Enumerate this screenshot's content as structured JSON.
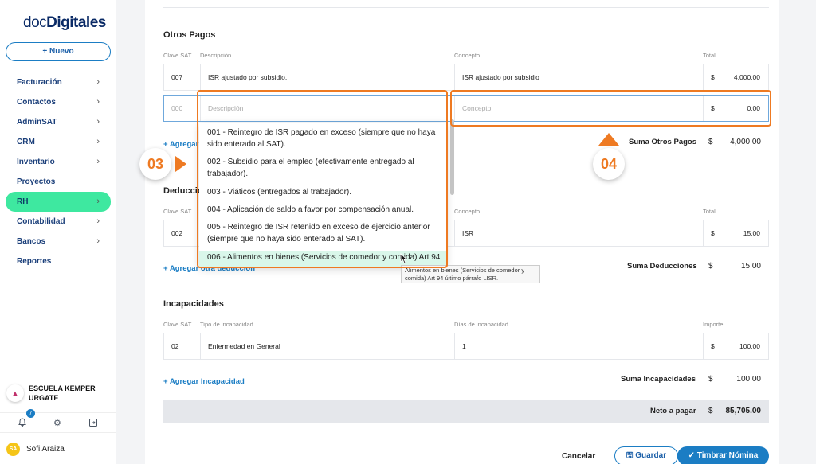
{
  "brand": {
    "logo_light": "doc",
    "logo_bold": "Digitales"
  },
  "sidebar": {
    "new_button": "+ Nuevo",
    "items": [
      {
        "label": "Facturación",
        "chevron": true
      },
      {
        "label": "Contactos",
        "chevron": true
      },
      {
        "label": "AdminSAT",
        "chevron": true
      },
      {
        "label": "CRM",
        "chevron": true
      },
      {
        "label": "Inventario",
        "chevron": true
      },
      {
        "label": "Proyectos",
        "chevron": false
      },
      {
        "label": "RH",
        "chevron": true,
        "active": true
      },
      {
        "label": "Contabilidad",
        "chevron": true
      },
      {
        "label": "Bancos",
        "chevron": true
      },
      {
        "label": "Reportes",
        "chevron": false
      }
    ],
    "org_name": "ESCUELA KEMPER URGATE",
    "notification_count": "7",
    "user_initials": "SA",
    "user_name": "Sofi Araiza"
  },
  "otros_pagos": {
    "title": "Otros Pagos",
    "headers": {
      "clave": "Clave SAT",
      "descripcion": "Descripción",
      "concepto": "Concepto",
      "total": "Total"
    },
    "row": {
      "clave": "007",
      "descripcion": "ISR ajustado por subsidio.",
      "concepto": "ISR ajustado por subsidio",
      "currency": "$",
      "total": "4,000.00"
    },
    "input_row": {
      "clave_placeholder": "000",
      "descripcion_placeholder": "Descripción",
      "concepto_placeholder": "Concepto",
      "currency": "$",
      "total": "0.00"
    },
    "add_link": "+ Agregar",
    "sum_label": "Suma Otros Pagos",
    "sum_currency": "$",
    "sum_value": "4,000.00"
  },
  "deducciones": {
    "title": "Deduccio",
    "headers": {
      "clave": "Clave SAT",
      "concepto": "Concepto",
      "total": "Total"
    },
    "row": {
      "clave": "002",
      "concepto": "ISR",
      "currency": "$",
      "total": "15.00"
    },
    "add_link": "+ Agregar otra deducción",
    "sum_label": "Suma Deducciones",
    "sum_currency": "$",
    "sum_value": "15.00"
  },
  "incapacidades": {
    "title": "Incapacidades",
    "headers": {
      "clave": "Clave SAT",
      "tipo": "Tipo de incapacidad",
      "dias": "Días de incapacidad",
      "importe": "Importe"
    },
    "row": {
      "clave": "02",
      "tipo": "Enfermedad en General",
      "dias": "1",
      "currency": "$",
      "importe": "100.00"
    },
    "add_link": "+ Agregar Incapacidad",
    "sum_label": "Suma Incapacidades",
    "sum_currency": "$",
    "sum_value": "100.00"
  },
  "neto": {
    "label": "Neto a pagar",
    "currency": "$",
    "value": "85,705.00"
  },
  "actions": {
    "cancel": "Cancelar",
    "save": "Guardar",
    "stamp": "Timbrar Nómina"
  },
  "dropdown": {
    "options": [
      "001 - Reintegro de ISR pagado en exceso (siempre que no haya sido enterado al SAT).",
      "002 - Subsidio para el empleo (efectivamente entregado al trabajador).",
      "003 - Viáticos (entregados al trabajador).",
      "004 - Aplicación de saldo a favor por compensación anual.",
      "005 - Reintegro de ISR retenido en exceso de ejercicio anterior (siempre que no haya sido enterado al SAT).",
      "006 - Alimentos en bienes (Servicios de comedor y comida) Art 94"
    ],
    "tooltip": "Alimentos en bienes (Servicios de comedor y comida) Art 94 último párrafo LISR."
  },
  "annotations": {
    "callout_1": "03",
    "callout_2": "04",
    "color": "#ee7a22"
  },
  "colors": {
    "accent": "#1b7dc4",
    "active_nav": "#3ee8a0",
    "highlight": "#ee7a22"
  }
}
